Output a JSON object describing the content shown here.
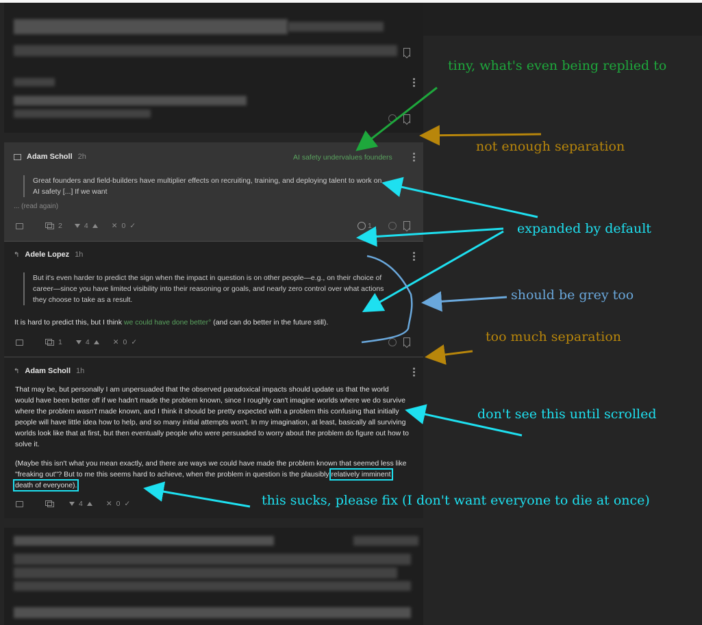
{
  "comments": [
    {
      "author": "Adam Scholl",
      "time": "2h",
      "reply_to": "AI safety undervalues founders",
      "quote": "Great founders and field-builders have multiplier effects on recruiting, training, and deploying talent to work on AI safety [...] If we want",
      "read_again": "... (read again)",
      "replies": "2",
      "karma": "4",
      "agree": "0",
      "reacts": "1"
    },
    {
      "author": "Adele Lopez",
      "time": "1h",
      "quote": "But it's even harder to predict the sign when the impact in question is on other people—e.g., on their choice of career—since you have limited visibility into their reasoning or goals, and nearly zero control over what actions they choose to take as a result.",
      "body_pre": "It is hard to predict this, but I think ",
      "body_link": "we could have done better°",
      "body_post": " (and can do better in the future still).",
      "replies": "1",
      "karma": "4",
      "agree": "0"
    },
    {
      "author": "Adam Scholl",
      "time": "1h",
      "p1_a": "That may be, but personally I am unpersuaded that the observed paradoxical impacts should update us that the world would have been better off if we hadn't made the problem known, since I roughly can't imagine worlds where we do survive where the problem ",
      "p1_em": "wasn't",
      "p1_b": " made known, and I think it should be pretty expected with a problem this confusing that initially people will have little idea how to help, and so many initial attempts won't. In my imagination, at least, basically all surviving worlds look like that at first, but then eventually people who were persuaded to worry about the problem do figure out how to solve it.",
      "p2_a": "(Maybe this isn't what you mean exactly, and there are ways we could have made the problem known that seemed less like \"freaking out\"? But to me this seems hard to achieve, when the problem in question is the plausibly ",
      "p2_b": "relatively imminent death of everyone).",
      "karma": "4",
      "agree": "0"
    }
  ],
  "annotations": {
    "tiny": "tiny, what's even being replied to",
    "not_enough": "not enough separation",
    "expanded": "expanded by default",
    "grey": "should be grey too",
    "too_much": "too much separation",
    "dont_see": "don't see this until scrolled",
    "sucks": "this sucks, please fix (I don't want everyone to die at once)"
  },
  "colors": {
    "annotation_green": "#1ea83c",
    "annotation_gold": "#b8860b",
    "annotation_cyan": "#1ee0f0",
    "annotation_blue": "#6aa8dc"
  }
}
